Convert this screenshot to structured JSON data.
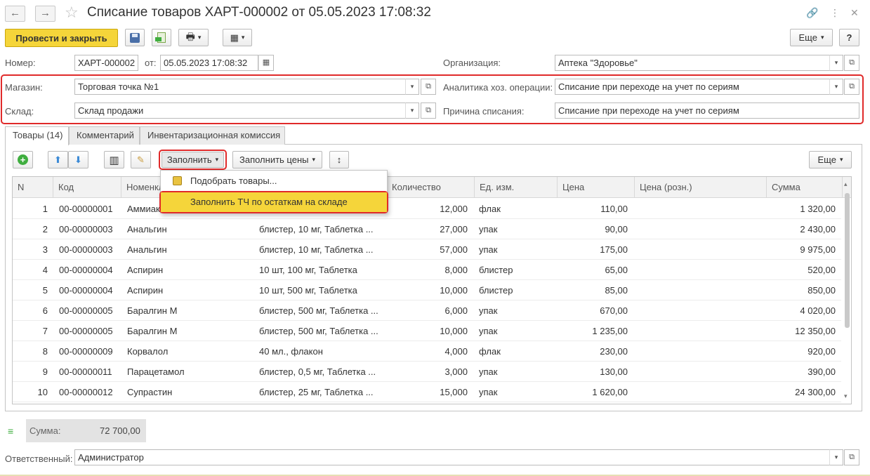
{
  "window": {
    "title": "Списание товаров ХАРТ-000002 от 05.05.2023 17:08:32",
    "back_icon": "←",
    "forward_icon": "→",
    "star_icon": "☆",
    "link_icon": "🔗",
    "more_icon": "⋮",
    "close_icon": "✕"
  },
  "toolbar": {
    "post_close_label": "Провести и закрыть",
    "more_label": "Еще",
    "more_arrow": "▾",
    "help_label": "?",
    "save_icon": "💾",
    "post_icon": "📗",
    "print_icon": "🖶",
    "structure_icon": "▦"
  },
  "header": {
    "number_label": "Номер:",
    "number_value": "ХАРТ-000002",
    "date_label": "от:",
    "date_value": "05.05.2023 17:08:32",
    "calendar_icon": "▦",
    "org_label": "Организация:",
    "org_value": "Аптека \"Здоровье\"",
    "store_label": "Магазин:",
    "store_value": "Торговая точка №1",
    "warehouse_label": "Склад:",
    "warehouse_value": "Склад продажи",
    "analytics_label": "Аналитика хоз. операции:",
    "analytics_value": "Списание при переходе на учет по сериям",
    "reason_label": "Причина списания:",
    "reason_value": "Списание при переходе на учет по сериям",
    "dropdown_glyph": "▾",
    "open_glyph": "⧉"
  },
  "tabs": [
    {
      "label": "Товары (14)"
    },
    {
      "label": "Комментарий"
    },
    {
      "label": "Инвентаризационная комиссия"
    }
  ],
  "table_toolbar": {
    "add_icon": "+",
    "up_icon": "⬆",
    "down_icon": "⬇",
    "barcode_icon": "▥",
    "clear_icon": "✎",
    "fill_label": "Заполнить",
    "fill_prices_label": "Заполнить цены",
    "height_icon": "↕",
    "more_label": "Еще",
    "arrow": "▾"
  },
  "fill_menu": {
    "item1": "Подобрать товары...",
    "item1_icon": "📦",
    "item2": "Заполнить ТЧ по остаткам на складе"
  },
  "columns": {
    "n": "N",
    "code": "Код",
    "name": "Номенклатура",
    "qty": "Количество",
    "unit": "Ед. изм.",
    "price": "Цена",
    "retail": "Цена (розн.)",
    "sum": "Сумма"
  },
  "rows": [
    {
      "n": "1",
      "code": "00-00000001",
      "name": "Аммиак",
      "char": "",
      "qty": "12,000",
      "unit": "флак",
      "price": "110,00",
      "retail": "",
      "sum": "1 320,00"
    },
    {
      "n": "2",
      "code": "00-00000003",
      "name": "Анальгин",
      "char": "блистер, 10 мг, Таблетка ...",
      "qty": "27,000",
      "unit": "упак",
      "price": "90,00",
      "retail": "",
      "sum": "2 430,00"
    },
    {
      "n": "3",
      "code": "00-00000003",
      "name": "Анальгин",
      "char": "блистер, 10 мг, Таблетка ...",
      "qty": "57,000",
      "unit": "упак",
      "price": "175,00",
      "retail": "",
      "sum": "9 975,00"
    },
    {
      "n": "4",
      "code": "00-00000004",
      "name": "Аспирин",
      "char": "10 шт, 100 мг, Таблетка",
      "qty": "8,000",
      "unit": "блистер",
      "price": "65,00",
      "retail": "",
      "sum": "520,00"
    },
    {
      "n": "5",
      "code": "00-00000004",
      "name": "Аспирин",
      "char": "10 шт, 500 мг, Таблетка",
      "qty": "10,000",
      "unit": "блистер",
      "price": "85,00",
      "retail": "",
      "sum": "850,00"
    },
    {
      "n": "6",
      "code": "00-00000005",
      "name": "Баралгин М",
      "char": "блистер, 500 мг, Таблетка ...",
      "qty": "6,000",
      "unit": "упак",
      "price": "670,00",
      "retail": "",
      "sum": "4 020,00"
    },
    {
      "n": "7",
      "code": "00-00000005",
      "name": "Баралгин М",
      "char": "блистер, 500 мг, Таблетка ...",
      "qty": "10,000",
      "unit": "упак",
      "price": "1 235,00",
      "retail": "",
      "sum": "12 350,00"
    },
    {
      "n": "8",
      "code": "00-00000009",
      "name": "Корвалол",
      "char": "40 мл., флакон",
      "qty": "4,000",
      "unit": "флак",
      "price": "230,00",
      "retail": "",
      "sum": "920,00"
    },
    {
      "n": "9",
      "code": "00-00000011",
      "name": "Парацетамол",
      "char": "блистер, 0,5 мг, Таблетка ...",
      "qty": "3,000",
      "unit": "упак",
      "price": "130,00",
      "retail": "",
      "sum": "390,00"
    },
    {
      "n": "10",
      "code": "00-00000012",
      "name": "Супрастин",
      "char": "блистер, 25 мг, Таблетка ...",
      "qty": "15,000",
      "unit": "упак",
      "price": "1 620,00",
      "retail": "",
      "sum": "24 300,00"
    }
  ],
  "scroll_up": "▴",
  "scroll_down": "▾",
  "footer": {
    "sum_icon": "≡",
    "sum_label": "Сумма:",
    "sum_value": "72 700,00",
    "responsible_label": "Ответственный:",
    "responsible_value": "Администратор"
  },
  "colors": {
    "accent_yellow": "#f5d53a",
    "highlight_red": "#e02a2a",
    "add_green": "#3fae3f",
    "arrow_blue": "#3b8ad6"
  }
}
